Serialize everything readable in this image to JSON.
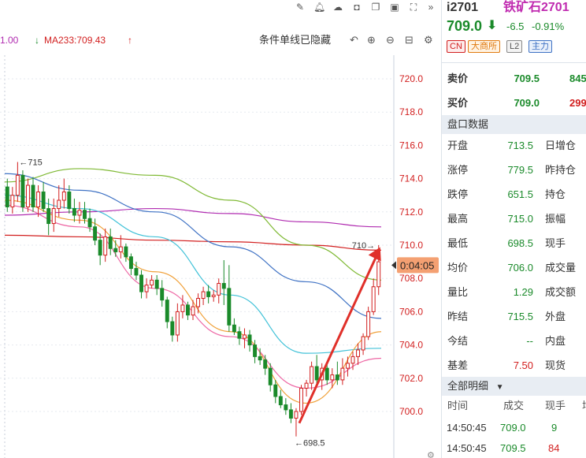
{
  "toolbar": {
    "icons": [
      "pencil-icon",
      "bell-icon",
      "cloud-icon",
      "camera-icon",
      "window-icon",
      "layout-icon",
      "expand-icon",
      "collapse-icon"
    ]
  },
  "legend": {
    "partial_value": "1.00",
    "ma233_label": "MA233:709.43",
    "ma233_color": "#d21f1f",
    "arrow_down": "↓",
    "arrow_up": "↑"
  },
  "controls": {
    "hidden_lines_text": "条件单线已隐藏"
  },
  "quote": {
    "symbol": "i2701",
    "name": "铁矿石2701",
    "price": "709.0",
    "change": "-6.5",
    "change_pct": "-0.91%",
    "tags": [
      "CN",
      "大商所",
      "L2",
      "主力"
    ],
    "ask_label": "卖价",
    "ask_price": "709.5",
    "ask_vol": "845",
    "bid_label": "买价",
    "bid_price": "709.0",
    "bid_vol": "299",
    "panel_title": "盘口数据",
    "stats": [
      {
        "label": "开盘",
        "value": "713.5",
        "label2": "日增仓"
      },
      {
        "label": "涨停",
        "value": "779.5",
        "label2": "昨持仓"
      },
      {
        "label": "跌停",
        "value": "651.5",
        "label2": "持仓"
      },
      {
        "label": "最高",
        "value": "715.0",
        "label2": "振幅"
      },
      {
        "label": "最低",
        "value": "698.5",
        "label2": "现手"
      },
      {
        "label": "均价",
        "value": "706.0",
        "label2": "成交量"
      },
      {
        "label": "量比",
        "value": "1.29",
        "label2": "成交额"
      },
      {
        "label": "昨结",
        "value": "715.5",
        "label2": "外盘"
      },
      {
        "label": "今结",
        "value": "--",
        "label2": "内盘"
      },
      {
        "label": "基差",
        "value": "7.50",
        "label2": "现货"
      }
    ],
    "ticks_title": "全部明细",
    "ticks_headers": [
      "时间",
      "成交",
      "现手",
      "增"
    ],
    "ticks": [
      {
        "time": "14:50:45",
        "price": "709.0",
        "qty": "9"
      },
      {
        "time": "14:50:45",
        "price": "709.5",
        "qty": "84"
      }
    ]
  },
  "chart_data": {
    "type": "candlestick",
    "y_ticks": [
      "720.0",
      "718.0",
      "716.0",
      "714.0",
      "712.0",
      "710.0",
      "708.0",
      "706.0",
      "704.0",
      "702.0",
      "700.0"
    ],
    "ylim": [
      699.1,
      721.2
    ],
    "countdown": "0:04:05",
    "high_marker": "←715",
    "low_marker": "←698.5",
    "last_marker": "710→",
    "high_value": 715.0,
    "low_value": 698.5,
    "candles": [
      {
        "o": 713.5,
        "h": 714.0,
        "l": 712.0,
        "c": 712.3
      },
      {
        "o": 712.3,
        "h": 713.5,
        "l": 711.9,
        "c": 713.0
      },
      {
        "o": 713.0,
        "h": 715.0,
        "l": 712.6,
        "c": 714.2
      },
      {
        "o": 714.2,
        "h": 714.5,
        "l": 712.0,
        "c": 712.3
      },
      {
        "o": 712.3,
        "h": 714.0,
        "l": 712.0,
        "c": 713.6
      },
      {
        "o": 713.6,
        "h": 714.1,
        "l": 712.0,
        "c": 712.3
      },
      {
        "o": 712.3,
        "h": 713.6,
        "l": 711.7,
        "c": 713.2
      },
      {
        "o": 713.2,
        "h": 713.8,
        "l": 712.0,
        "c": 712.2
      },
      {
        "o": 712.2,
        "h": 712.8,
        "l": 710.6,
        "c": 711.3
      },
      {
        "o": 711.3,
        "h": 712.8,
        "l": 710.8,
        "c": 712.2
      },
      {
        "o": 712.2,
        "h": 713.6,
        "l": 711.7,
        "c": 712.7
      },
      {
        "o": 712.7,
        "h": 714.0,
        "l": 712.2,
        "c": 713.2
      },
      {
        "o": 713.2,
        "h": 713.6,
        "l": 711.9,
        "c": 712.2
      },
      {
        "o": 712.2,
        "h": 712.8,
        "l": 711.4,
        "c": 711.8
      },
      {
        "o": 711.8,
        "h": 712.6,
        "l": 711.3,
        "c": 712.1
      },
      {
        "o": 712.1,
        "h": 712.6,
        "l": 711.3,
        "c": 711.6
      },
      {
        "o": 711.6,
        "h": 712.2,
        "l": 710.8,
        "c": 711.1
      },
      {
        "o": 711.1,
        "h": 711.6,
        "l": 710.0,
        "c": 710.3
      },
      {
        "o": 710.3,
        "h": 710.7,
        "l": 708.8,
        "c": 709.4
      },
      {
        "o": 709.4,
        "h": 711.0,
        "l": 709.0,
        "c": 710.5
      },
      {
        "o": 710.5,
        "h": 711.0,
        "l": 709.4,
        "c": 709.8
      },
      {
        "o": 709.8,
        "h": 710.3,
        "l": 709.3,
        "c": 709.6
      },
      {
        "o": 709.6,
        "h": 710.6,
        "l": 709.2,
        "c": 709.9
      },
      {
        "o": 709.9,
        "h": 710.1,
        "l": 709.0,
        "c": 709.3
      },
      {
        "o": 709.3,
        "h": 709.5,
        "l": 708.2,
        "c": 708.6
      },
      {
        "o": 708.6,
        "h": 709.0,
        "l": 707.9,
        "c": 708.2
      },
      {
        "o": 708.2,
        "h": 708.5,
        "l": 706.8,
        "c": 707.2
      },
      {
        "o": 707.2,
        "h": 708.0,
        "l": 706.8,
        "c": 707.6
      },
      {
        "o": 707.6,
        "h": 708.2,
        "l": 707.4,
        "c": 707.9
      },
      {
        "o": 707.9,
        "h": 708.2,
        "l": 707.0,
        "c": 707.4
      },
      {
        "o": 707.4,
        "h": 707.9,
        "l": 706.3,
        "c": 706.7
      },
      {
        "o": 706.7,
        "h": 706.9,
        "l": 705.0,
        "c": 705.4
      },
      {
        "o": 705.4,
        "h": 705.7,
        "l": 704.2,
        "c": 704.6
      },
      {
        "o": 704.6,
        "h": 706.5,
        "l": 704.2,
        "c": 706.0
      },
      {
        "o": 706.0,
        "h": 707.0,
        "l": 705.6,
        "c": 706.4
      },
      {
        "o": 706.4,
        "h": 706.6,
        "l": 705.5,
        "c": 705.8
      },
      {
        "o": 705.8,
        "h": 706.7,
        "l": 705.5,
        "c": 706.3
      },
      {
        "o": 706.3,
        "h": 707.1,
        "l": 705.9,
        "c": 706.8
      },
      {
        "o": 706.8,
        "h": 707.5,
        "l": 706.4,
        "c": 707.2
      },
      {
        "o": 707.2,
        "h": 707.6,
        "l": 706.5,
        "c": 706.9
      },
      {
        "o": 706.9,
        "h": 707.3,
        "l": 706.6,
        "c": 707.0
      },
      {
        "o": 707.0,
        "h": 708.0,
        "l": 706.5,
        "c": 707.7
      },
      {
        "o": 707.7,
        "h": 709.1,
        "l": 706.4,
        "c": 707.4
      },
      {
        "o": 707.4,
        "h": 708.8,
        "l": 704.8,
        "c": 705.2
      },
      {
        "o": 705.2,
        "h": 705.6,
        "l": 704.6,
        "c": 704.8
      },
      {
        "o": 704.8,
        "h": 705.1,
        "l": 704.0,
        "c": 704.4
      },
      {
        "o": 704.4,
        "h": 705.0,
        "l": 703.8,
        "c": 704.6
      },
      {
        "o": 704.6,
        "h": 704.9,
        "l": 703.6,
        "c": 704.0
      },
      {
        "o": 704.0,
        "h": 704.3,
        "l": 702.9,
        "c": 703.3
      },
      {
        "o": 703.3,
        "h": 703.8,
        "l": 702.8,
        "c": 703.1
      },
      {
        "o": 703.1,
        "h": 703.4,
        "l": 702.2,
        "c": 702.6
      },
      {
        "o": 702.6,
        "h": 702.9,
        "l": 701.2,
        "c": 701.6
      },
      {
        "o": 701.6,
        "h": 701.9,
        "l": 700.5,
        "c": 700.9
      },
      {
        "o": 700.9,
        "h": 701.3,
        "l": 700.2,
        "c": 700.4
      },
      {
        "o": 700.4,
        "h": 700.8,
        "l": 699.8,
        "c": 700.1
      },
      {
        "o": 700.1,
        "h": 700.5,
        "l": 699.3,
        "c": 699.6
      },
      {
        "o": 699.6,
        "h": 700.2,
        "l": 698.5,
        "c": 700.0
      },
      {
        "o": 700.0,
        "h": 701.6,
        "l": 699.8,
        "c": 701.4
      },
      {
        "o": 701.4,
        "h": 701.9,
        "l": 700.9,
        "c": 701.7
      },
      {
        "o": 701.7,
        "h": 703.0,
        "l": 701.3,
        "c": 702.7
      },
      {
        "o": 702.7,
        "h": 703.4,
        "l": 701.5,
        "c": 701.9
      },
      {
        "o": 701.9,
        "h": 702.9,
        "l": 701.3,
        "c": 702.6
      },
      {
        "o": 702.6,
        "h": 703.0,
        "l": 701.6,
        "c": 701.9
      },
      {
        "o": 701.9,
        "h": 702.6,
        "l": 701.4,
        "c": 702.2
      },
      {
        "o": 702.2,
        "h": 703.0,
        "l": 701.6,
        "c": 701.9
      },
      {
        "o": 701.9,
        "h": 703.2,
        "l": 701.6,
        "c": 702.6
      },
      {
        "o": 702.6,
        "h": 703.3,
        "l": 702.1,
        "c": 702.9
      },
      {
        "o": 702.9,
        "h": 703.6,
        "l": 702.5,
        "c": 703.3
      },
      {
        "o": 703.3,
        "h": 704.1,
        "l": 702.8,
        "c": 703.7
      },
      {
        "o": 703.7,
        "h": 704.7,
        "l": 703.4,
        "c": 704.5
      },
      {
        "o": 704.5,
        "h": 706.3,
        "l": 704.3,
        "c": 706.0
      },
      {
        "o": 706.0,
        "h": 708.0,
        "l": 705.8,
        "c": 707.5
      },
      {
        "o": 707.5,
        "h": 710.0,
        "l": 707.0,
        "c": 709.0
      }
    ],
    "ma_lines": [
      {
        "name": "MA233",
        "color": "#d21f1f",
        "values": [
          710.6,
          710.5,
          710.3,
          710.2,
          710.0,
          709.7
        ]
      },
      {
        "name": "ma-purple",
        "color": "#b02bb0",
        "values": [
          711.8,
          712.0,
          712.2,
          711.9,
          711.4,
          711.1
        ]
      },
      {
        "name": "ma-green",
        "color": "#7fb934",
        "values": [
          713.8,
          714.6,
          714.2,
          712.7,
          710.0,
          707.9
        ]
      },
      {
        "name": "ma-blue",
        "color": "#3f72c4",
        "values": [
          714.3,
          713.3,
          712.0,
          709.9,
          707.8,
          705.6
        ]
      },
      {
        "name": "ma-cyan",
        "color": "#42c2d8",
        "values": [
          713.0,
          712.2,
          710.5,
          707.0,
          703.5,
          703.8
        ]
      },
      {
        "name": "ma-orange",
        "color": "#f0a13a",
        "values": [
          712.7,
          711.5,
          708.4,
          704.8,
          700.5,
          704.8
        ]
      },
      {
        "name": "ma-pink",
        "color": "#ee6aa6",
        "values": [
          712.4,
          711.1,
          707.4,
          704.5,
          701.4,
          703.2
        ]
      }
    ],
    "trend_arrow": {
      "from_value": 699.3,
      "to_value": 709.6,
      "color": "#e0302a"
    }
  }
}
